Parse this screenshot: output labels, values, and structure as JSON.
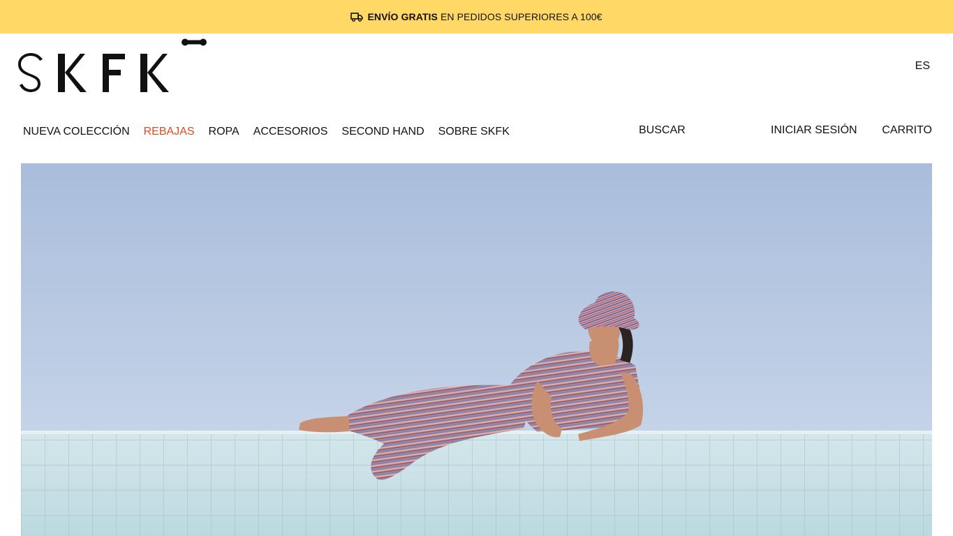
{
  "promo": {
    "icon": "truck-icon",
    "bold_text": "ENVÍO GRATIS",
    "text": "EN PEDIDOS SUPERIORES A 100€"
  },
  "brand": {
    "logo_text": "SKFK"
  },
  "header": {
    "language": "ES"
  },
  "nav": {
    "items": [
      {
        "label": "NUEVA COLECCIÓN"
      },
      {
        "label": "REBAJAS",
        "highlight": "#e14a22"
      },
      {
        "label": "ROPA"
      },
      {
        "label": "ACCESORIOS"
      },
      {
        "label": "SECOND HAND"
      },
      {
        "label": "SOBRE SKFK"
      }
    ],
    "search_label": "BUSCAR",
    "login_label": "INICIAR SESIÓN",
    "cart_label": "CARRITO"
  },
  "colors": {
    "promo_bg": "#ffd866",
    "sale_accent": "#e14a22",
    "sky": "#b9c9e2",
    "tiles": "#c9e1e8"
  }
}
